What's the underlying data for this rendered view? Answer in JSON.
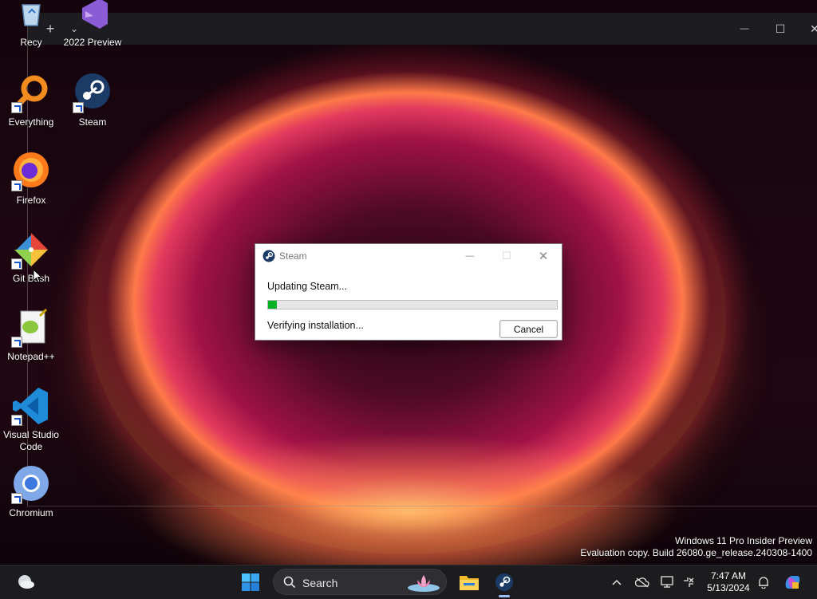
{
  "desktop": {
    "icons": [
      {
        "label": "Recy",
        "icon": "recycle-bin-icon"
      },
      {
        "label": "2022 Preview",
        "icon": "visual-studio-icon"
      },
      {
        "label": "Everything",
        "icon": "everything-search-icon"
      },
      {
        "label": "Steam",
        "icon": "steam-icon"
      },
      {
        "label": "Firefox",
        "icon": "firefox-icon"
      },
      {
        "label": "Git Bash",
        "icon": "git-bash-icon"
      },
      {
        "label": "Notepad++",
        "icon": "notepad-plus-plus-icon"
      },
      {
        "label": "Visual Studio Code",
        "icon": "vscode-icon"
      },
      {
        "label": "Chromium",
        "icon": "chromium-icon"
      }
    ]
  },
  "terminal": {
    "new_tab": "+",
    "dropdown": "⌄",
    "minimize": "—",
    "maximize": "☐",
    "close": "✕"
  },
  "dialog": {
    "title": "Steam",
    "heading": "Updating Steam...",
    "status": "Verifying installation...",
    "cancel_label": "Cancel",
    "progress_percent": 3,
    "progress_color": "#06b025",
    "minimize": "—",
    "maximize": "☐",
    "close": "✕"
  },
  "watermark": {
    "line1": "Windows 11 Pro Insider Preview",
    "line2": "Evaluation copy. Build 26080.ge_release.240308-1400"
  },
  "taskbar": {
    "search_label": "Search",
    "time": "7:47 AM",
    "date": "5/13/2024",
    "pinned": [
      "start-icon",
      "file-explorer-icon",
      "steam-icon"
    ],
    "tray_icons": [
      "chevron-up-icon",
      "onedrive-icon",
      "display-icon",
      "network-icon",
      "notification-bell-icon",
      "copilot-icon"
    ]
  },
  "colors": {
    "accent": "#0078d4",
    "taskbar_bg": "#1c1c1f",
    "progress": "#06b025"
  }
}
